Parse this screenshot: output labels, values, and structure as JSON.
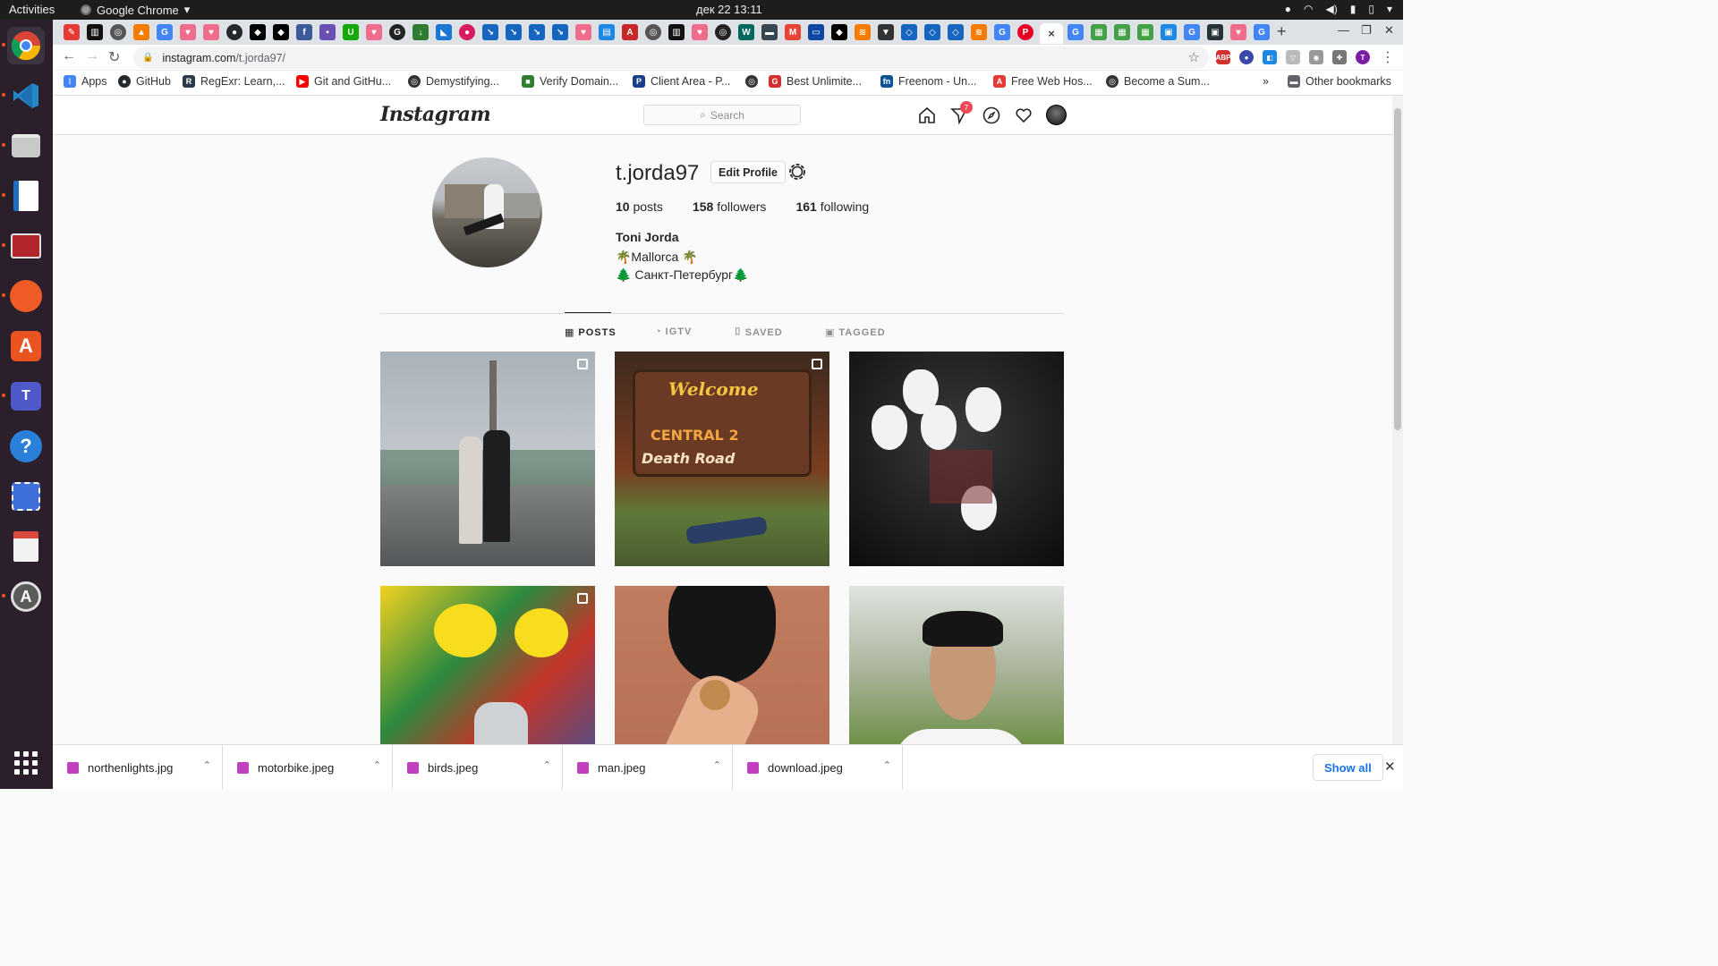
{
  "os": {
    "activities": "Activities",
    "app_name": "Google Chrome",
    "clock": "дек 22  13:11"
  },
  "browser": {
    "url_host": "instagram.com",
    "url_path": "/t.jorda97/",
    "bookmarks": [
      {
        "label": "Apps",
        "icon": "apps-grid-icon",
        "color": "#4285f4"
      },
      {
        "label": "GitHub",
        "icon": "github-icon",
        "color": "#24292e"
      },
      {
        "label": "RegExr: Learn,...",
        "icon": "regexr-icon",
        "color": "#2b3a4a"
      },
      {
        "label": "Git and GitHu...",
        "icon": "youtube-icon",
        "color": "#ff0000"
      },
      {
        "label": "Demystifying...",
        "icon": "site-icon",
        "color": "#333333"
      },
      {
        "label": "Verify Domain...",
        "icon": "lock-icon",
        "color": "#2e7d32"
      },
      {
        "label": "Client Area - P...",
        "icon": "site-icon",
        "color": "#1a3e8a"
      },
      {
        "label": "",
        "icon": "site-icon",
        "color": "#333333"
      },
      {
        "label": "Best Unlimite...",
        "icon": "site-icon",
        "color": "#d32f2f"
      },
      {
        "label": "Freenom - Un...",
        "icon": "freenom-icon",
        "color": "#0b5394"
      },
      {
        "label": "Free Web Hos...",
        "icon": "site-icon",
        "color": "#e53935"
      },
      {
        "label": "Become a Sum...",
        "icon": "site-icon",
        "color": "#333333"
      }
    ],
    "bookmarks_overflow": "»",
    "other_bookmarks": "Other bookmarks",
    "profile_initial": "T"
  },
  "instagram": {
    "search_placeholder": "Search",
    "notification_count": "7",
    "username": "t.jorda97",
    "edit_profile": "Edit Profile",
    "stats": [
      {
        "count": "10",
        "label": "posts"
      },
      {
        "count": "158",
        "label": "followers"
      },
      {
        "count": "161",
        "label": "following"
      }
    ],
    "full_name": "Toni Jorda",
    "bio_line1": "🌴Mallorca 🌴",
    "bio_line2": "🌲 Санкт-Петербург🌲",
    "tabs": [
      {
        "label": "POSTS",
        "active": true
      },
      {
        "label": "IGTV",
        "active": false
      },
      {
        "label": "SAVED",
        "active": false
      },
      {
        "label": "TAGGED",
        "active": false
      }
    ]
  },
  "downloads": {
    "files": [
      "northenlights.jpg",
      "motorbike.jpeg",
      "birds.jpeg",
      "man.jpeg",
      "download.jpeg"
    ],
    "show_all": "Show all"
  }
}
